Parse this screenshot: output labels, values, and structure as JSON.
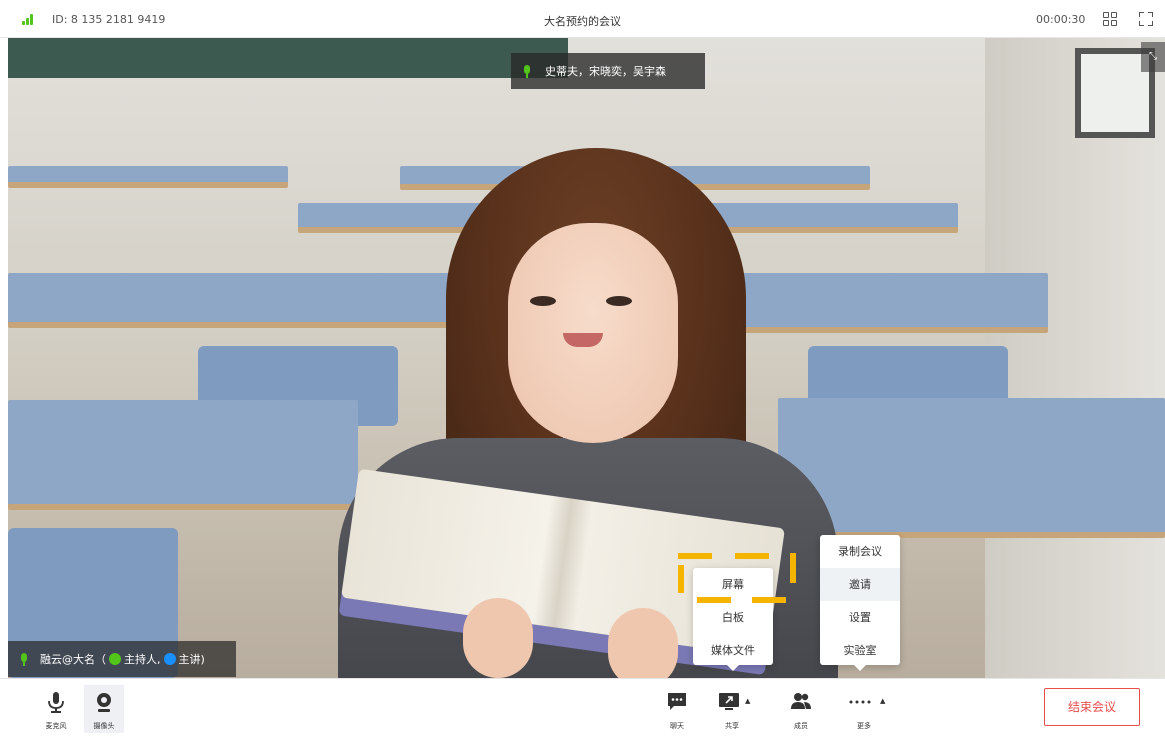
{
  "topbar": {
    "meeting_id": "ID: 8 135 2181 9419",
    "title": "大名预约的会议",
    "timer": "00:00:30"
  },
  "video": {
    "active_speakers": "史蒂夫，宋晓奕，吴宇森",
    "local_user": "融云@大名",
    "role_open": "（",
    "role_host": "主持人,",
    "role_presenter": "主讲)",
    "exit_fullscreen_glyph": "⤡"
  },
  "share_menu": {
    "items": [
      {
        "label": "屏幕"
      },
      {
        "label": "白板"
      },
      {
        "label": "媒体文件"
      }
    ]
  },
  "more_menu": {
    "items": [
      {
        "label": "录制会议"
      },
      {
        "label": "邀请"
      },
      {
        "label": "设置"
      },
      {
        "label": "实验室"
      }
    ],
    "active_index": 1
  },
  "toolbar": {
    "mic": "麦克风",
    "camera": "摄像头",
    "chat": "聊天",
    "share": "共享",
    "members": "成员",
    "more": "更多",
    "end_meeting": "结束会议"
  },
  "colors": {
    "accent_green": "#52c41a",
    "accent_blue": "#1890ff",
    "danger_red": "#e84d4d",
    "highlight_yellow": "#f5b400"
  }
}
